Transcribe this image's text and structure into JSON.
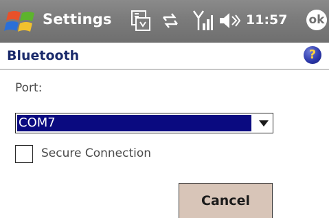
{
  "titlebar": {
    "app_title": "Settings",
    "clock": "11:57",
    "ok_label": "ok",
    "status_icons": [
      "input-panel-icon",
      "connectivity-icon",
      "signal-strength-icon",
      "volume-icon"
    ]
  },
  "header": {
    "title": "Bluetooth",
    "help_glyph": "?"
  },
  "form": {
    "port_label": "Port:",
    "port_value": "COM7",
    "secure_label": "Secure Connection",
    "secure_checked": false
  },
  "buttons": {
    "cancel_label": "Cancel"
  },
  "colors": {
    "titlebar": "#7b7b7b",
    "selection": "#0a0a80",
    "header_text": "#1a2a6b",
    "button_face": "#d8c5b8"
  }
}
